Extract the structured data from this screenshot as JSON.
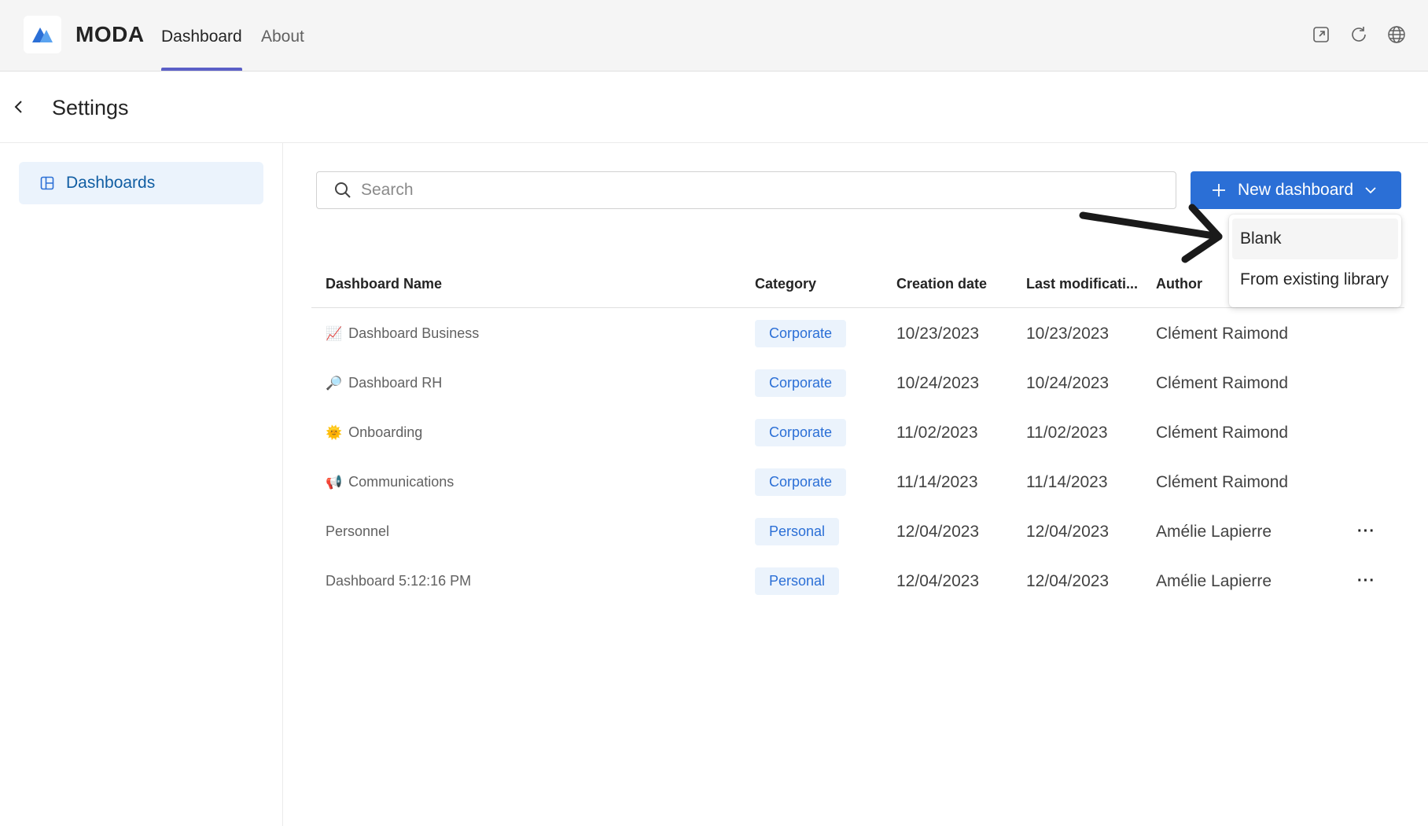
{
  "app": {
    "name": "MODA",
    "nav_tabs": [
      {
        "label": "Dashboard",
        "active": true
      },
      {
        "label": "About",
        "active": false
      }
    ],
    "top_icons": [
      "open-external-icon",
      "refresh-icon",
      "globe-icon"
    ]
  },
  "settings": {
    "title": "Settings"
  },
  "sidebar": {
    "items": [
      {
        "label": "Dashboards",
        "icon": "dashboard-grid-icon",
        "selected": true
      }
    ]
  },
  "search": {
    "placeholder": "Search",
    "value": ""
  },
  "new_dashboard": {
    "label": "New dashboard",
    "menu": [
      {
        "label": "Blank",
        "hovered": true
      },
      {
        "label": "From existing library",
        "hovered": false
      }
    ]
  },
  "table": {
    "columns": [
      "Dashboard Name",
      "Category",
      "Creation date",
      "Last modificati...",
      "Author"
    ],
    "rows": [
      {
        "emoji": "📈",
        "name": "Dashboard Business",
        "category": "Corporate",
        "created": "10/23/2023",
        "modified": "10/23/2023",
        "author": "Clément Raimond",
        "has_menu": false
      },
      {
        "emoji": "🔎",
        "name": "Dashboard RH",
        "category": "Corporate",
        "created": "10/24/2023",
        "modified": "10/24/2023",
        "author": "Clément Raimond",
        "has_menu": false
      },
      {
        "emoji": "🌞",
        "name": "Onboarding",
        "category": "Corporate",
        "created": "11/02/2023",
        "modified": "11/02/2023",
        "author": "Clément Raimond",
        "has_menu": false
      },
      {
        "emoji": "📢",
        "name": "Communications",
        "category": "Corporate",
        "created": "11/14/2023",
        "modified": "11/14/2023",
        "author": "Clément Raimond",
        "has_menu": false
      },
      {
        "emoji": "",
        "name": "Personnel",
        "category": "Personal",
        "created": "12/04/2023",
        "modified": "12/04/2023",
        "author": "Amélie Lapierre",
        "has_menu": true
      },
      {
        "emoji": "",
        "name": "Dashboard 5:12:16 PM",
        "category": "Personal",
        "created": "12/04/2023",
        "modified": "12/04/2023",
        "author": "Amélie Lapierre",
        "has_menu": true
      }
    ],
    "more_label": "···"
  },
  "colors": {
    "accent": "#2b6fd6",
    "nav_underline": "#5b5fc7",
    "badge_bg": "#ebf3fc",
    "sidebar_selected_bg": "#ebf3fc"
  }
}
